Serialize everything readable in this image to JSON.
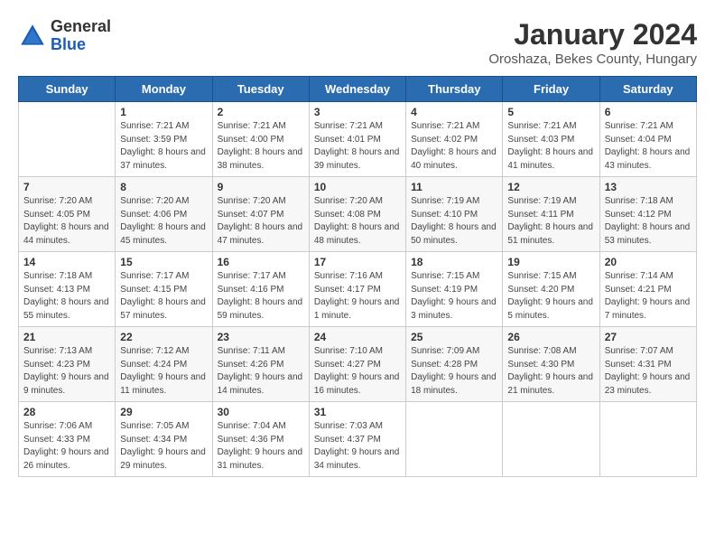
{
  "header": {
    "logo_general": "General",
    "logo_blue": "Blue",
    "month_title": "January 2024",
    "location": "Oroshaza, Bekes County, Hungary"
  },
  "weekdays": [
    "Sunday",
    "Monday",
    "Tuesday",
    "Wednesday",
    "Thursday",
    "Friday",
    "Saturday"
  ],
  "weeks": [
    [
      {
        "day": null,
        "sunrise": null,
        "sunset": null,
        "daylight": null
      },
      {
        "day": "1",
        "sunrise": "Sunrise: 7:21 AM",
        "sunset": "Sunset: 3:59 PM",
        "daylight": "Daylight: 8 hours and 37 minutes."
      },
      {
        "day": "2",
        "sunrise": "Sunrise: 7:21 AM",
        "sunset": "Sunset: 4:00 PM",
        "daylight": "Daylight: 8 hours and 38 minutes."
      },
      {
        "day": "3",
        "sunrise": "Sunrise: 7:21 AM",
        "sunset": "Sunset: 4:01 PM",
        "daylight": "Daylight: 8 hours and 39 minutes."
      },
      {
        "day": "4",
        "sunrise": "Sunrise: 7:21 AM",
        "sunset": "Sunset: 4:02 PM",
        "daylight": "Daylight: 8 hours and 40 minutes."
      },
      {
        "day": "5",
        "sunrise": "Sunrise: 7:21 AM",
        "sunset": "Sunset: 4:03 PM",
        "daylight": "Daylight: 8 hours and 41 minutes."
      },
      {
        "day": "6",
        "sunrise": "Sunrise: 7:21 AM",
        "sunset": "Sunset: 4:04 PM",
        "daylight": "Daylight: 8 hours and 43 minutes."
      }
    ],
    [
      {
        "day": "7",
        "sunrise": "Sunrise: 7:20 AM",
        "sunset": "Sunset: 4:05 PM",
        "daylight": "Daylight: 8 hours and 44 minutes."
      },
      {
        "day": "8",
        "sunrise": "Sunrise: 7:20 AM",
        "sunset": "Sunset: 4:06 PM",
        "daylight": "Daylight: 8 hours and 45 minutes."
      },
      {
        "day": "9",
        "sunrise": "Sunrise: 7:20 AM",
        "sunset": "Sunset: 4:07 PM",
        "daylight": "Daylight: 8 hours and 47 minutes."
      },
      {
        "day": "10",
        "sunrise": "Sunrise: 7:20 AM",
        "sunset": "Sunset: 4:08 PM",
        "daylight": "Daylight: 8 hours and 48 minutes."
      },
      {
        "day": "11",
        "sunrise": "Sunrise: 7:19 AM",
        "sunset": "Sunset: 4:10 PM",
        "daylight": "Daylight: 8 hours and 50 minutes."
      },
      {
        "day": "12",
        "sunrise": "Sunrise: 7:19 AM",
        "sunset": "Sunset: 4:11 PM",
        "daylight": "Daylight: 8 hours and 51 minutes."
      },
      {
        "day": "13",
        "sunrise": "Sunrise: 7:18 AM",
        "sunset": "Sunset: 4:12 PM",
        "daylight": "Daylight: 8 hours and 53 minutes."
      }
    ],
    [
      {
        "day": "14",
        "sunrise": "Sunrise: 7:18 AM",
        "sunset": "Sunset: 4:13 PM",
        "daylight": "Daylight: 8 hours and 55 minutes."
      },
      {
        "day": "15",
        "sunrise": "Sunrise: 7:17 AM",
        "sunset": "Sunset: 4:15 PM",
        "daylight": "Daylight: 8 hours and 57 minutes."
      },
      {
        "day": "16",
        "sunrise": "Sunrise: 7:17 AM",
        "sunset": "Sunset: 4:16 PM",
        "daylight": "Daylight: 8 hours and 59 minutes."
      },
      {
        "day": "17",
        "sunrise": "Sunrise: 7:16 AM",
        "sunset": "Sunset: 4:17 PM",
        "daylight": "Daylight: 9 hours and 1 minute."
      },
      {
        "day": "18",
        "sunrise": "Sunrise: 7:15 AM",
        "sunset": "Sunset: 4:19 PM",
        "daylight": "Daylight: 9 hours and 3 minutes."
      },
      {
        "day": "19",
        "sunrise": "Sunrise: 7:15 AM",
        "sunset": "Sunset: 4:20 PM",
        "daylight": "Daylight: 9 hours and 5 minutes."
      },
      {
        "day": "20",
        "sunrise": "Sunrise: 7:14 AM",
        "sunset": "Sunset: 4:21 PM",
        "daylight": "Daylight: 9 hours and 7 minutes."
      }
    ],
    [
      {
        "day": "21",
        "sunrise": "Sunrise: 7:13 AM",
        "sunset": "Sunset: 4:23 PM",
        "daylight": "Daylight: 9 hours and 9 minutes."
      },
      {
        "day": "22",
        "sunrise": "Sunrise: 7:12 AM",
        "sunset": "Sunset: 4:24 PM",
        "daylight": "Daylight: 9 hours and 11 minutes."
      },
      {
        "day": "23",
        "sunrise": "Sunrise: 7:11 AM",
        "sunset": "Sunset: 4:26 PM",
        "daylight": "Daylight: 9 hours and 14 minutes."
      },
      {
        "day": "24",
        "sunrise": "Sunrise: 7:10 AM",
        "sunset": "Sunset: 4:27 PM",
        "daylight": "Daylight: 9 hours and 16 minutes."
      },
      {
        "day": "25",
        "sunrise": "Sunrise: 7:09 AM",
        "sunset": "Sunset: 4:28 PM",
        "daylight": "Daylight: 9 hours and 18 minutes."
      },
      {
        "day": "26",
        "sunrise": "Sunrise: 7:08 AM",
        "sunset": "Sunset: 4:30 PM",
        "daylight": "Daylight: 9 hours and 21 minutes."
      },
      {
        "day": "27",
        "sunrise": "Sunrise: 7:07 AM",
        "sunset": "Sunset: 4:31 PM",
        "daylight": "Daylight: 9 hours and 23 minutes."
      }
    ],
    [
      {
        "day": "28",
        "sunrise": "Sunrise: 7:06 AM",
        "sunset": "Sunset: 4:33 PM",
        "daylight": "Daylight: 9 hours and 26 minutes."
      },
      {
        "day": "29",
        "sunrise": "Sunrise: 7:05 AM",
        "sunset": "Sunset: 4:34 PM",
        "daylight": "Daylight: 9 hours and 29 minutes."
      },
      {
        "day": "30",
        "sunrise": "Sunrise: 7:04 AM",
        "sunset": "Sunset: 4:36 PM",
        "daylight": "Daylight: 9 hours and 31 minutes."
      },
      {
        "day": "31",
        "sunrise": "Sunrise: 7:03 AM",
        "sunset": "Sunset: 4:37 PM",
        "daylight": "Daylight: 9 hours and 34 minutes."
      },
      {
        "day": null,
        "sunrise": null,
        "sunset": null,
        "daylight": null
      },
      {
        "day": null,
        "sunrise": null,
        "sunset": null,
        "daylight": null
      },
      {
        "day": null,
        "sunrise": null,
        "sunset": null,
        "daylight": null
      }
    ]
  ]
}
